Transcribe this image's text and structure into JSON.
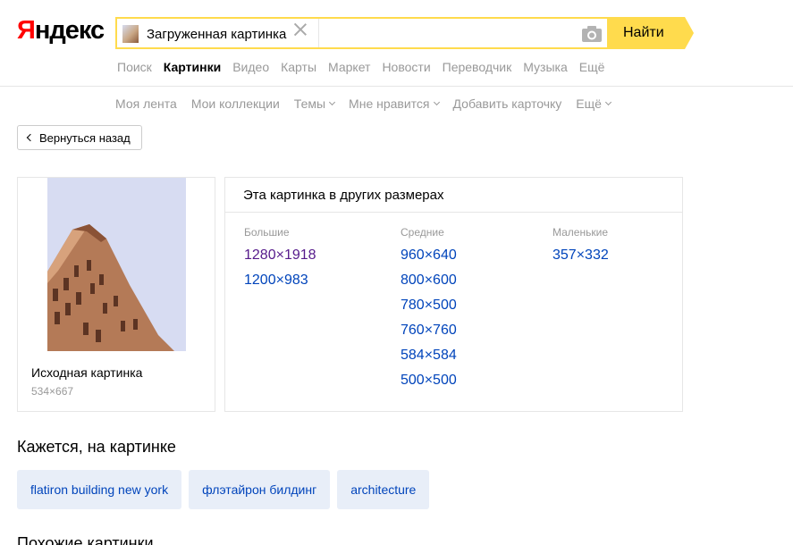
{
  "logo": {
    "first_letter": "Я",
    "rest": "ндекс"
  },
  "search": {
    "chip_label": "Загруженная картинка",
    "find_label": "Найти",
    "icons": {
      "clear": "close-icon",
      "camera": "camera-icon"
    }
  },
  "services": [
    {
      "label": "Поиск",
      "active": false
    },
    {
      "label": "Картинки",
      "active": true
    },
    {
      "label": "Видео",
      "active": false
    },
    {
      "label": "Карты",
      "active": false
    },
    {
      "label": "Маркет",
      "active": false
    },
    {
      "label": "Новости",
      "active": false
    },
    {
      "label": "Переводчик",
      "active": false
    },
    {
      "label": "Музыка",
      "active": false
    },
    {
      "label": "Ещё",
      "active": false
    }
  ],
  "subnav": [
    {
      "label": "Моя лента",
      "dropdown": false
    },
    {
      "label": "Мои коллекции",
      "dropdown": false
    },
    {
      "label": "Темы",
      "dropdown": true
    },
    {
      "label": "Мне нравится",
      "dropdown": true
    },
    {
      "label": "Добавить карточку",
      "dropdown": false
    },
    {
      "label": "Ещё",
      "dropdown": true
    }
  ],
  "back_button": "Вернуться назад",
  "original": {
    "title": "Исходная картинка",
    "size": "534×667"
  },
  "sizes": {
    "heading": "Эта картинка в других размерах",
    "columns": [
      {
        "title": "Большие",
        "items": [
          "1280×1918",
          "1200×983"
        ]
      },
      {
        "title": "Средние",
        "items": [
          "960×640",
          "800×600",
          "780×500",
          "760×760",
          "584×584",
          "500×500"
        ]
      },
      {
        "title": "Маленькие",
        "items": [
          "357×332"
        ]
      }
    ]
  },
  "seems": {
    "title": "Кажется, на картинке",
    "tags": [
      "flatiron building new york",
      "флэтайрон билдинг",
      "architecture"
    ]
  },
  "similar_title": "Похожие картинки",
  "colors": {
    "accent": "#ffdb4d",
    "link": "#0044bb",
    "visited": "#551a8b",
    "logo_red": "#ff0000"
  }
}
